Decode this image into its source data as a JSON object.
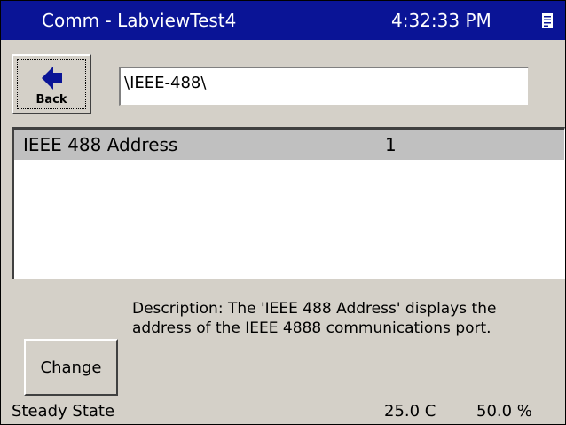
{
  "titlebar": {
    "title": "Comm - LabviewTest4",
    "time": "4:32:33 PM",
    "icon": "document-icon"
  },
  "toolbar": {
    "back_label": "Back",
    "back_icon": "left-arrow-icon",
    "path_value": "\\IEEE-488\\"
  },
  "list": {
    "rows": [
      {
        "name": "IEEE 488 Address",
        "value": "1"
      }
    ]
  },
  "description": {
    "line1": "Description:  The 'IEEE 488 Address' displays the",
    "line2": "address of the IEEE 4888 communications port."
  },
  "actions": {
    "change_label": "Change"
  },
  "statusbar": {
    "state": "Steady State",
    "temperature": "25.0 C",
    "humidity": "50.0 %"
  },
  "colors": {
    "titlebar_bg": "#0a1496",
    "panel_bg": "#d4d0c8",
    "selected_row": "#c0c0c0"
  }
}
